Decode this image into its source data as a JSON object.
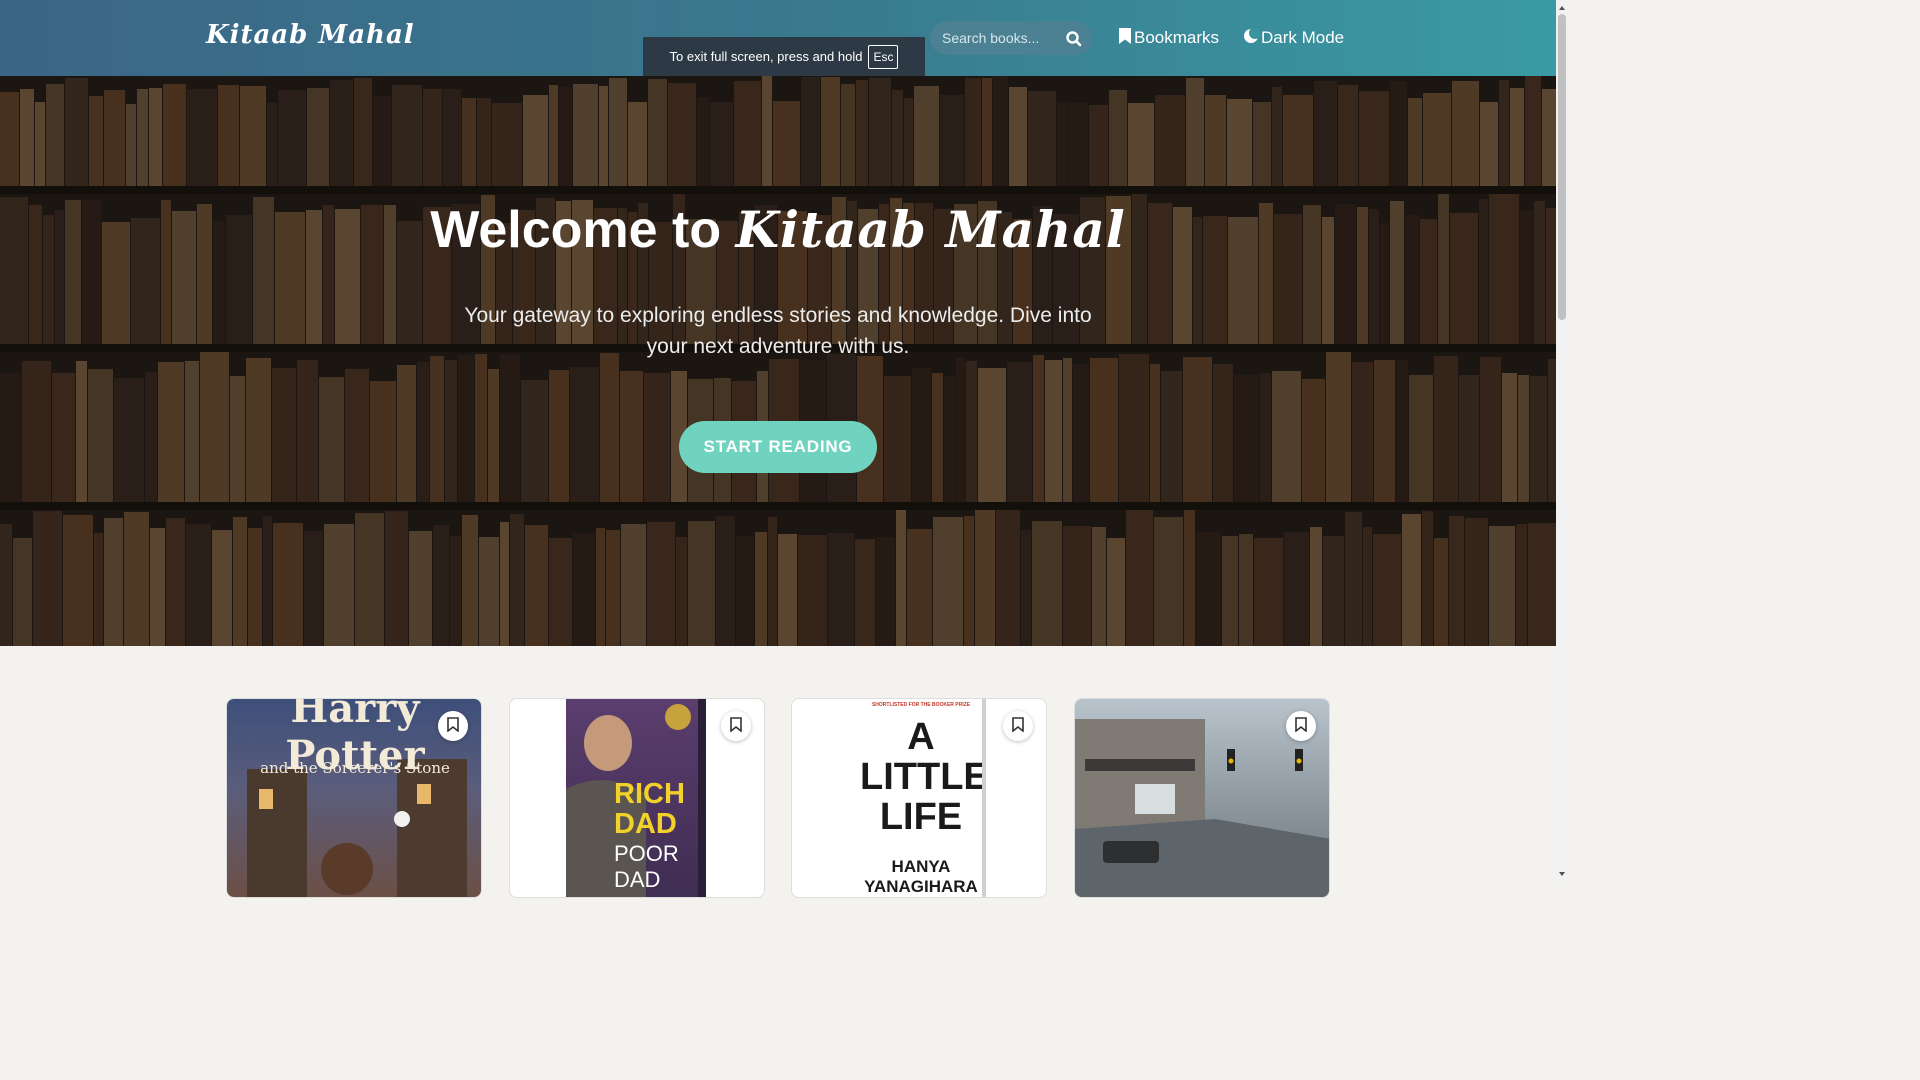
{
  "navbar": {
    "brand": "Kitaab Mahal",
    "search_placeholder": "Search books...",
    "search_icon": "search-icon",
    "bookmarks_label": "Bookmarks",
    "bookmarks_icon": "bookmark-icon",
    "dark_mode_label": "Dark Mode",
    "dark_mode_icon": "moon-icon"
  },
  "fullscreen_toast": {
    "text": "To exit full screen, press and hold",
    "key": "Esc"
  },
  "hero": {
    "title_prefix": "Welcome to",
    "title_brand": "Kitaab Mahal",
    "subtitle": "Your gateway to exploring endless stories and knowledge. Dive into your next adventure with us.",
    "cta_label": "START READING"
  },
  "books": [
    {
      "cover_text": "Harry Potter",
      "cover_subtext": "and the Sorcerer's Stone",
      "bookmark_icon": "bookmark-icon"
    },
    {
      "cover_text": "RICH DAD",
      "cover_subtext": "POOR DAD",
      "bookmark_icon": "bookmark-icon"
    },
    {
      "cover_banner": "SHORTLISTED FOR THE BOOKER PRIZE",
      "cover_text": "A LITTLE LIFE",
      "cover_author": "HANYA YANAGIHARA",
      "bookmark_icon": "bookmark-icon"
    },
    {
      "cover_text": "",
      "bookmark_icon": "bookmark-icon"
    }
  ],
  "colors": {
    "nav_gradient_start": "#3b6686",
    "nav_gradient_end": "#3a9ba4",
    "cta": "#6fd3bf",
    "page_bg": "#f4f2ee"
  }
}
